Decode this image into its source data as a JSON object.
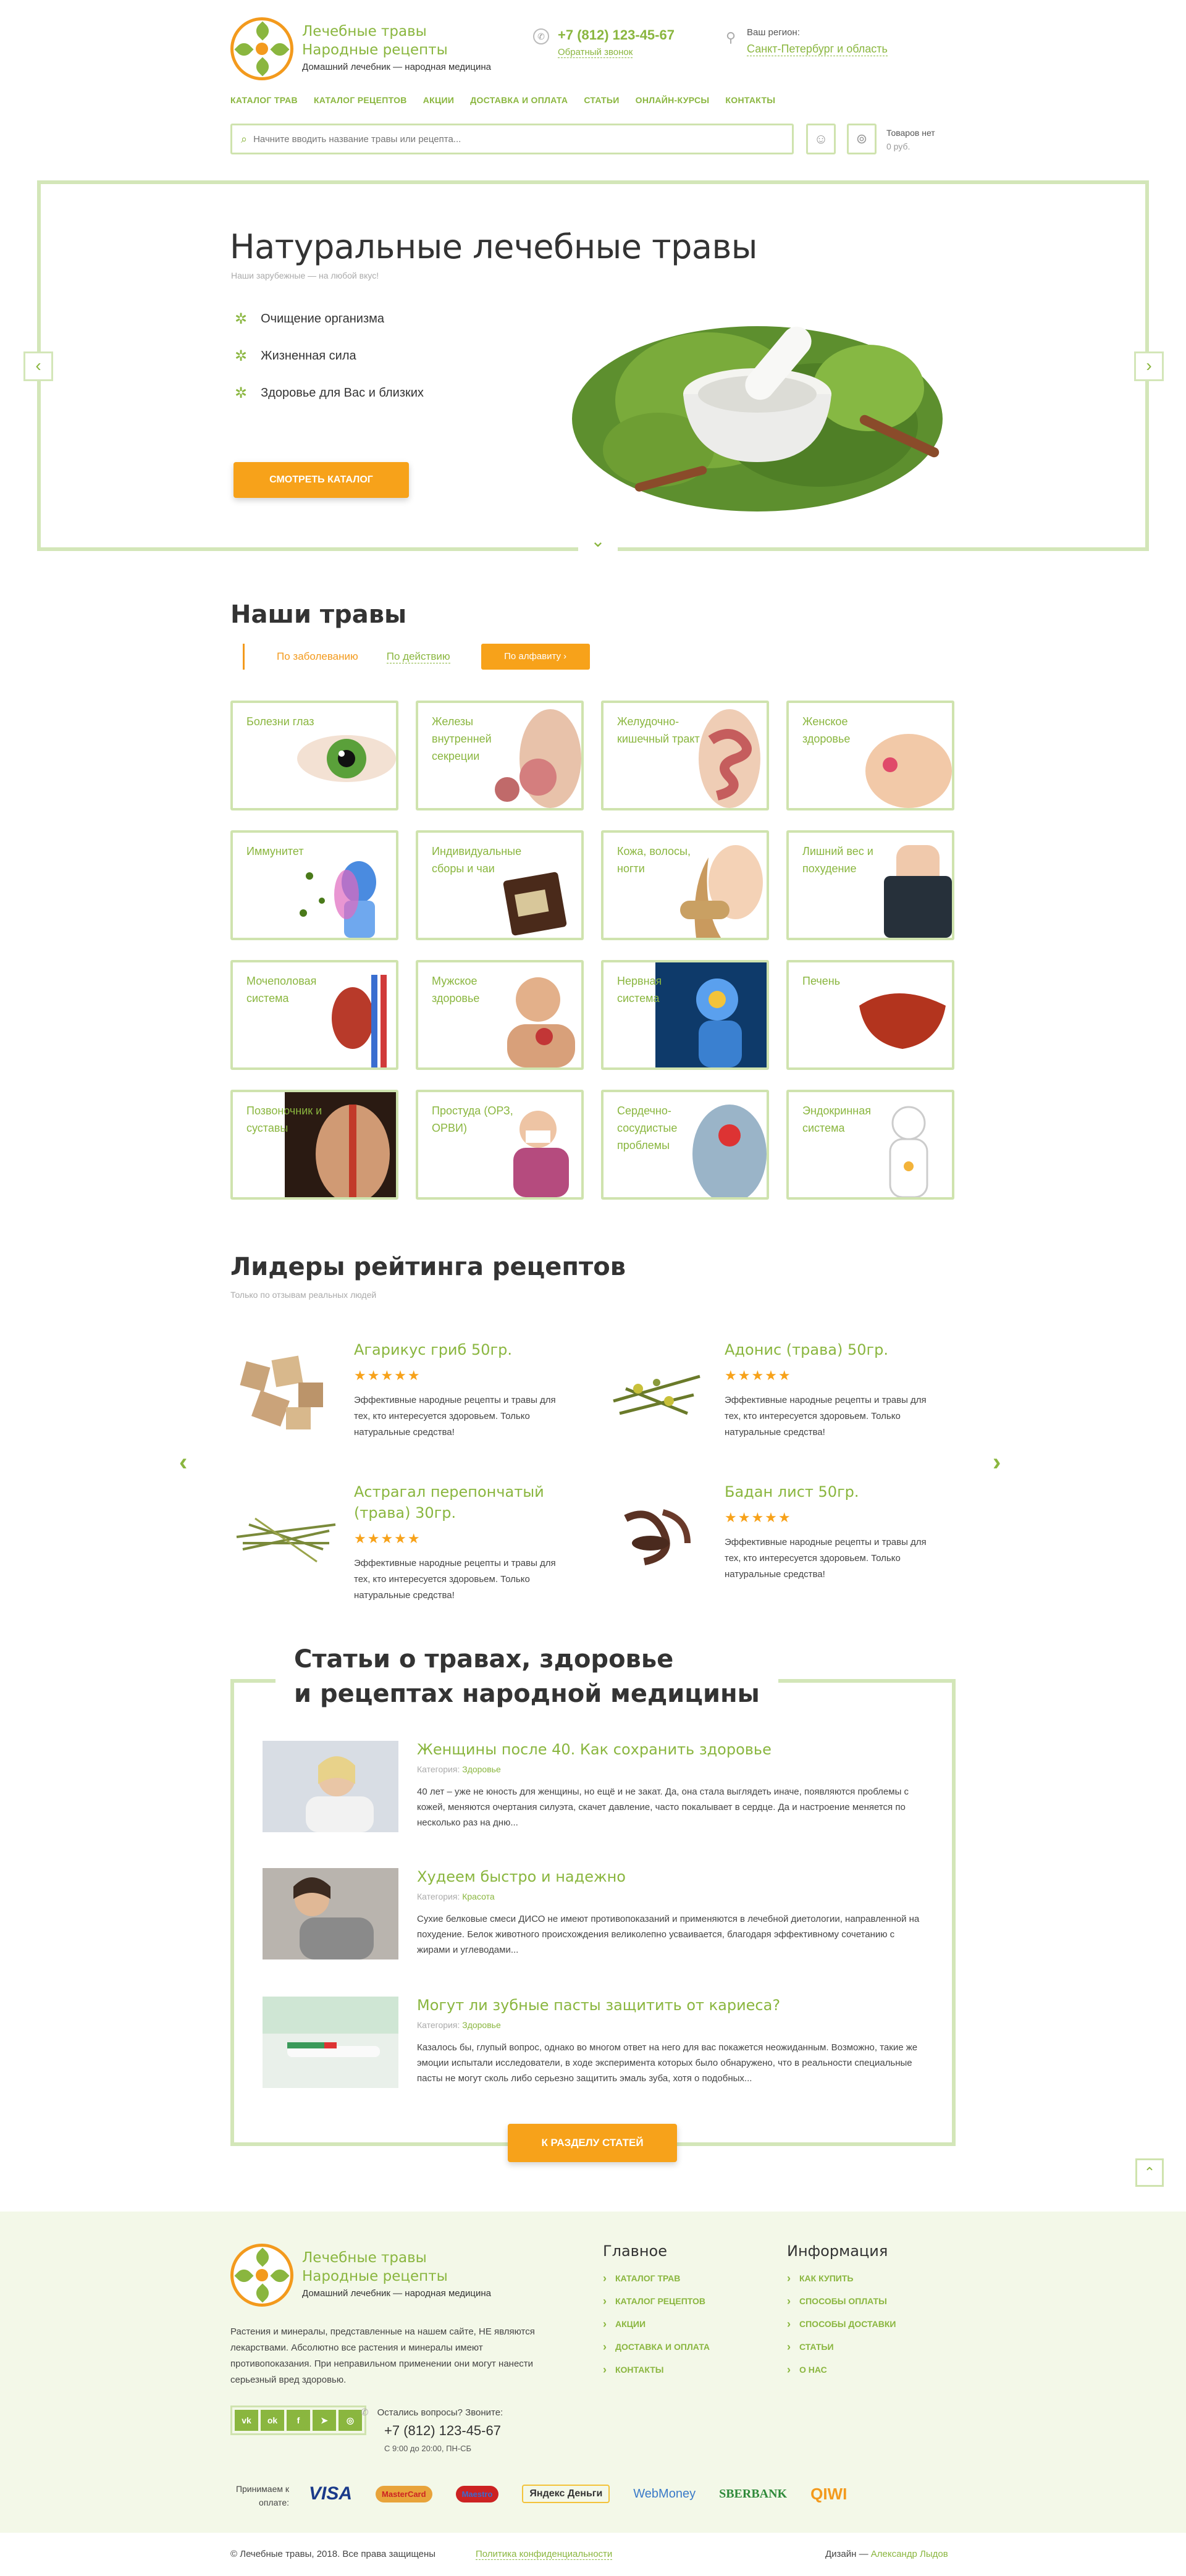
{
  "header": {
    "logo_title_1": "Лечебные травы",
    "logo_title_2": "Народные рецепты",
    "logo_sub": "Домашний лечебник — народная медицина",
    "phone": "+7 (812) 123-45-67",
    "callback": "Обратный звонок",
    "region_label": "Ваш регион:",
    "region_value": "Санкт-Петербург и область",
    "nav": [
      "КАТАЛОГ ТРАВ",
      "КАТАЛОГ РЕЦЕПТОВ",
      "АКЦИИ",
      "ДОСТАВКА И ОПЛАТА",
      "СТАТЬИ",
      "ОНЛАЙН-КУРСЫ",
      "КОНТАКТЫ"
    ],
    "search_placeholder": "Начните вводить название травы или рецепта...",
    "cart_label": "Товаров нет",
    "cart_sum": "0 руб."
  },
  "hero": {
    "title": "Натуральные лечебные травы",
    "subtitle": "Наши зарубежные — на любой вкус!",
    "bullets": [
      "Очищение организма",
      "Жизненная сила",
      "Здоровье для Вас и близких"
    ],
    "button": "СМОТРЕТЬ КАТАЛОГ"
  },
  "herbs": {
    "title": "Наши травы",
    "tab_active": "По заболеванию",
    "tab_link": "По действию",
    "tab_button": "По алфавиту ›",
    "cards": [
      "Болезни глаз",
      "Железы внутренней секреции",
      "Желудочно-кишечный тракт",
      "Женское здоровье",
      "Иммунитет",
      "Индивидуальные сборы и чаи",
      "Кожа, волосы, ногти",
      "Лишний вес и похудение",
      "Мочеполовая система",
      "Мужское здоровье",
      "Нервная система",
      "Печень",
      "Позвоночник и суставы",
      "Простуда (ОРЗ, ОРВИ)",
      "Сердечно-сосудистые проблемы",
      "Эндокринная система"
    ]
  },
  "leaders": {
    "title": "Лидеры рейтинга рецептов",
    "subtitle": "Только по отзывам реальных людей",
    "items": [
      {
        "name": "Агарикус гриб 50гр.",
        "stars": "★★★★★",
        "desc": "Эффективные народные рецепты и травы для тех, кто интересуется здоровьем. Только натуральные средства!"
      },
      {
        "name": "Адонис (трава) 50гр.",
        "stars": "★★★★★",
        "desc": "Эффективные народные рецепты и травы для тех, кто интересуется здоровьем. Только натуральные средства!"
      },
      {
        "name": "Астрагал перепончатый (трава) 30гр.",
        "stars": "★★★★★",
        "desc": "Эффективные народные рецепты и травы для тех, кто интересуется здоровьем. Только натуральные средства!"
      },
      {
        "name": "Бадан лист 50гр.",
        "stars": "★★★★★",
        "desc": "Эффективные народные рецепты и травы для тех, кто интересуется здоровьем. Только натуральные средства!"
      }
    ]
  },
  "articles": {
    "title_1": "Статьи о травах, здоровье",
    "title_2": "и рецептах народной медицины",
    "category_label": "Категория:",
    "items": [
      {
        "title": "Женщины после 40. Как сохранить здоровье",
        "category": "Здоровье",
        "text": "40 лет – уже не юность для женщины, но ещё и не закат. Да, она стала выглядеть иначе, появляются проблемы с кожей, меняются очертания силуэта, скачет давление, часто покалывает в сердце. Да и настроение меняется по несколько раз на дню..."
      },
      {
        "title": "Худеем быстро и надежно",
        "category": "Красота",
        "text": "Сухие белковые смеси ДИСО не имеют противопоказаний и применяются в лечебной диетологии, направленной на похудение. Белок животного происхождения великолепно усваивается, благодаря эффективному сочетанию с жирами и углеводами..."
      },
      {
        "title": "Могут ли зубные пасты защитить от кариеса?",
        "category": "Здоровье",
        "text": "Казалось бы, глупый вопрос, однако во многом ответ на него для вас покажется неожиданным. Возможно, такие же эмоции испытали исследователи, в ходе эксперимента которых было обнаружено, что в реальности специальные пасты не могут сколь либо серьезно защитить эмаль зуба, хотя о подобных..."
      }
    ],
    "button": "К РАЗДЕЛУ СТАТЕЙ"
  },
  "footer": {
    "logo_title_1": "Лечебные травы",
    "logo_title_2": "Народные рецепты",
    "logo_sub": "Домашний лечебник — народная медицина",
    "about": "Растения и минералы, представленные на нашем сайте, НЕ являются лекарствами. Абсолютно все растения и минералы имеют противопоказания. При неправильном применении они могут нанести серьезный вред здоровью.",
    "socials": [
      "vk",
      "ok",
      "f",
      "tg",
      "ig"
    ],
    "question": "Остались вопросы? Звоните:",
    "phone": "+7 (812) 123-45-67",
    "hours": "С 9:00 до 20:00, ПН-СБ",
    "col1_title": "Главное",
    "col1": [
      "КАТАЛОГ ТРАВ",
      "КАТАЛОГ РЕЦЕПТОВ",
      "АКЦИИ",
      "ДОСТАВКА И ОПЛАТА",
      "КОНТАКТЫ"
    ],
    "col2_title": "Информация",
    "col2": [
      "КАК КУПИТЬ",
      "СПОСОБЫ ОПЛАТЫ",
      "СПОСОБЫ ДОСТАВКИ",
      "СТАТЬИ",
      "О НАС"
    ],
    "pay_label": "Принимаем к оплате:",
    "pay": [
      "VISA",
      "MasterCard",
      "Maestro",
      "Яндекс Деньги",
      "WebMoney",
      "SBERBANK",
      "QIWI"
    ]
  },
  "bottom": {
    "copyright": "© Лечебные травы, 2018. Все права защищены",
    "policy": "Политика конфиденциальности",
    "design_label": "Дизайн —",
    "designer": "Александр Лыдов"
  },
  "colors": {
    "accent": "#8ab63f",
    "orange": "#f7a21a",
    "border": "#d3e6b8",
    "footer_bg": "#f3f8e8"
  }
}
